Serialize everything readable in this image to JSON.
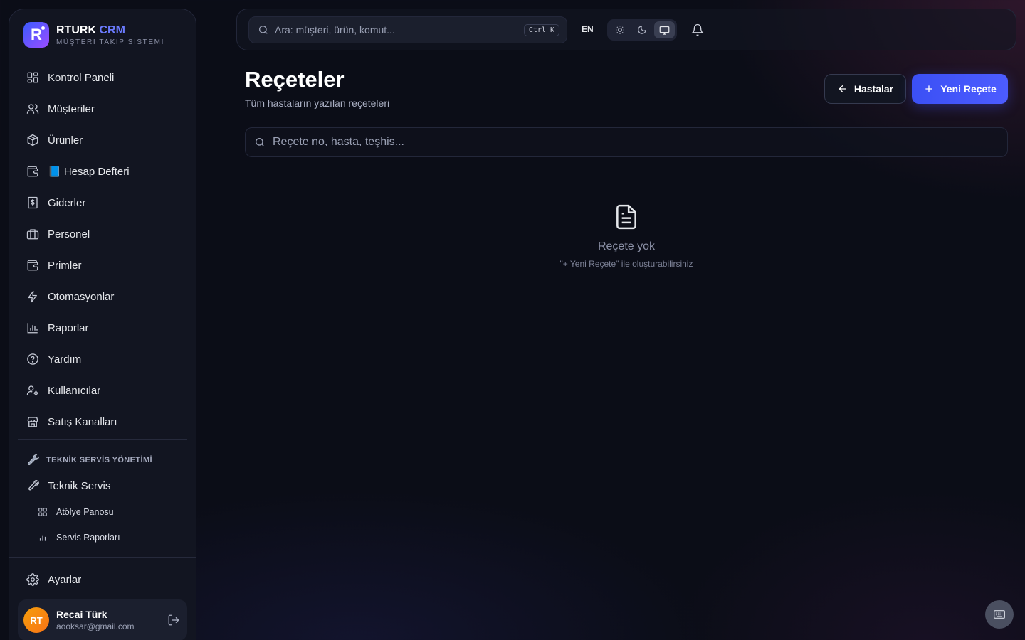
{
  "brand": {
    "name": "RTURK",
    "accent": "CRM",
    "subtitle": "MÜŞTERİ TAKİP SİSTEMİ",
    "logo_letter": "R"
  },
  "sidebar": {
    "items": [
      {
        "label": "Kontrol Paneli",
        "icon": "dashboard-icon"
      },
      {
        "label": "Müşteriler",
        "icon": "users-icon"
      },
      {
        "label": "Ürünler",
        "icon": "package-icon"
      },
      {
        "label": "📘 Hesap Defteri",
        "icon": "wallet-icon"
      },
      {
        "label": "Giderler",
        "icon": "receipt-icon"
      },
      {
        "label": "Personel",
        "icon": "briefcase-icon"
      },
      {
        "label": "Primler",
        "icon": "wallet-icon"
      },
      {
        "label": "Otomasyonlar",
        "icon": "zap-icon"
      },
      {
        "label": "Raporlar",
        "icon": "bar-chart-icon"
      },
      {
        "label": "Yardım",
        "icon": "help-icon"
      },
      {
        "label": "Kullanıcılar",
        "icon": "user-cog-icon"
      },
      {
        "label": "Satış Kanalları",
        "icon": "store-icon"
      }
    ],
    "section_title": "TEKNİK SERVİS YÖNETİMİ",
    "service": {
      "label": "Teknik Servis",
      "icon": "wrench-icon"
    },
    "sub_items": [
      {
        "label": "Atölye Panosu",
        "icon": "grid-icon"
      },
      {
        "label": "Servis Raporları",
        "icon": "bar-chart-icon"
      }
    ],
    "settings": {
      "label": "Ayarlar",
      "icon": "gear-icon"
    }
  },
  "user": {
    "initials": "RT",
    "name": "Recai Türk",
    "email": "aooksar@gmail.com"
  },
  "topbar": {
    "search_placeholder": "Ara: müşteri, ürün, komut...",
    "shortcut": "Ctrl K",
    "language": "EN",
    "theme_active": "system"
  },
  "page": {
    "title": "Reçeteler",
    "subtitle": "Tüm hastaların yazılan reçeteleri",
    "back_button": "Hastalar",
    "new_button": "Yeni Reçete",
    "search_placeholder": "Reçete no, hasta, teşhis...",
    "empty_title": "Reçete yok",
    "empty_hint": "\"+ Yeni Reçete\" ile oluşturabilirsiniz"
  },
  "colors": {
    "accent": "#4355ff",
    "background": "#0b0d17",
    "sidebar": "#121521",
    "avatar": "#f59e0b"
  }
}
